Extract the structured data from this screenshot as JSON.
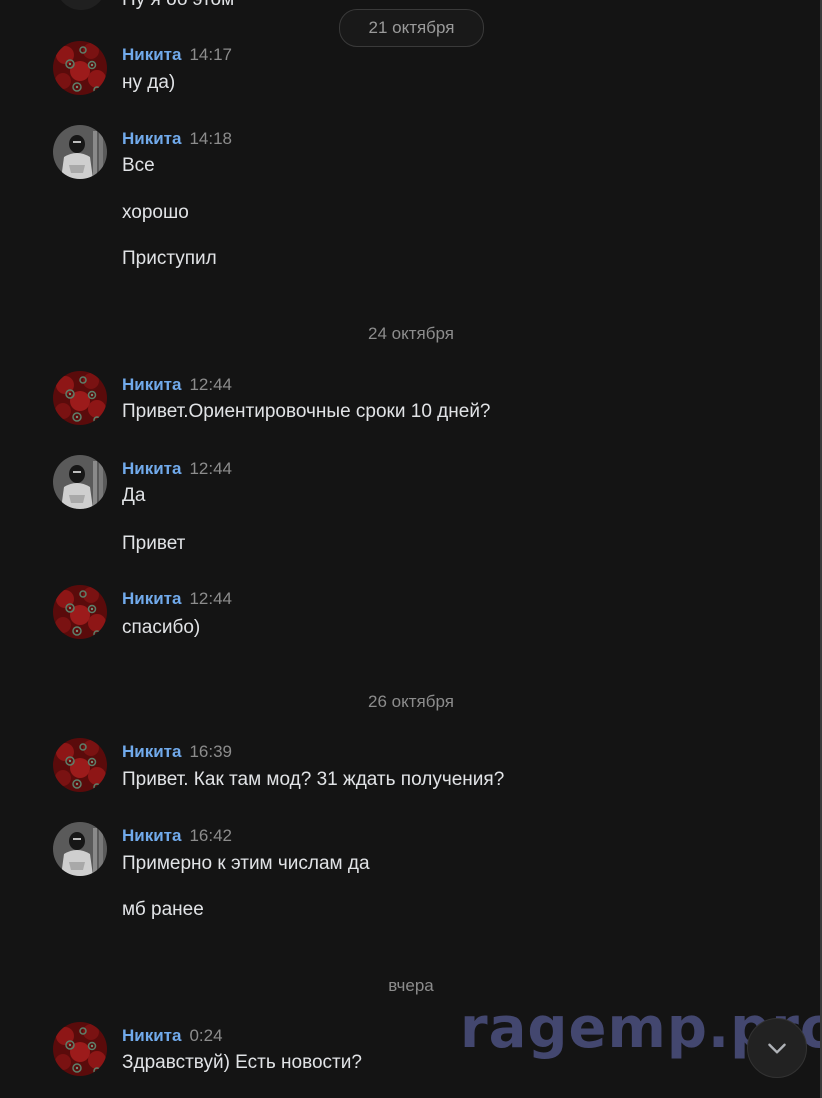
{
  "top_partial_text": "Ну я об этом",
  "current_date_pill": "21 октября",
  "date_separators": [
    "24 октября",
    "26 октября",
    "вчера"
  ],
  "messages": [
    {
      "author": "Никита",
      "time": "14:17",
      "avatar": "red-pattern-avatar",
      "lines": [
        "ну да)"
      ]
    },
    {
      "author": "Никита",
      "time": "14:18",
      "avatar": "hooded-person-avatar",
      "lines": [
        "Все",
        "хорошо",
        "Приступил"
      ]
    },
    {
      "author": "Никита",
      "time": "12:44",
      "avatar": "red-pattern-avatar",
      "lines": [
        "Привет.Ориентировочные сроки 10 дней?"
      ]
    },
    {
      "author": "Никита",
      "time": "12:44",
      "avatar": "hooded-person-avatar",
      "lines": [
        "Да",
        "Привет"
      ]
    },
    {
      "author": "Никита",
      "time": "12:44",
      "avatar": "red-pattern-avatar",
      "lines": [
        "спасибо)"
      ]
    },
    {
      "author": "Никита",
      "time": "16:39",
      "avatar": "red-pattern-avatar",
      "lines": [
        "Привет. Как там мод? 31 ждать получения?"
      ]
    },
    {
      "author": "Никита",
      "time": "16:42",
      "avatar": "hooded-person-avatar",
      "lines": [
        "Примерно к этим числам да",
        "мб ранее"
      ]
    },
    {
      "author": "Никита",
      "time": "0:24",
      "avatar": "red-pattern-avatar",
      "lines": [
        "Здравствуй) Есть новости?"
      ]
    }
  ],
  "watermark": "ragemp.pro",
  "scroll_down_icon": "chevron-down-icon",
  "colors": {
    "background": "#141414",
    "author": "#71aaeb",
    "text": "#e1e3e6",
    "muted": "#8c8c8c"
  }
}
